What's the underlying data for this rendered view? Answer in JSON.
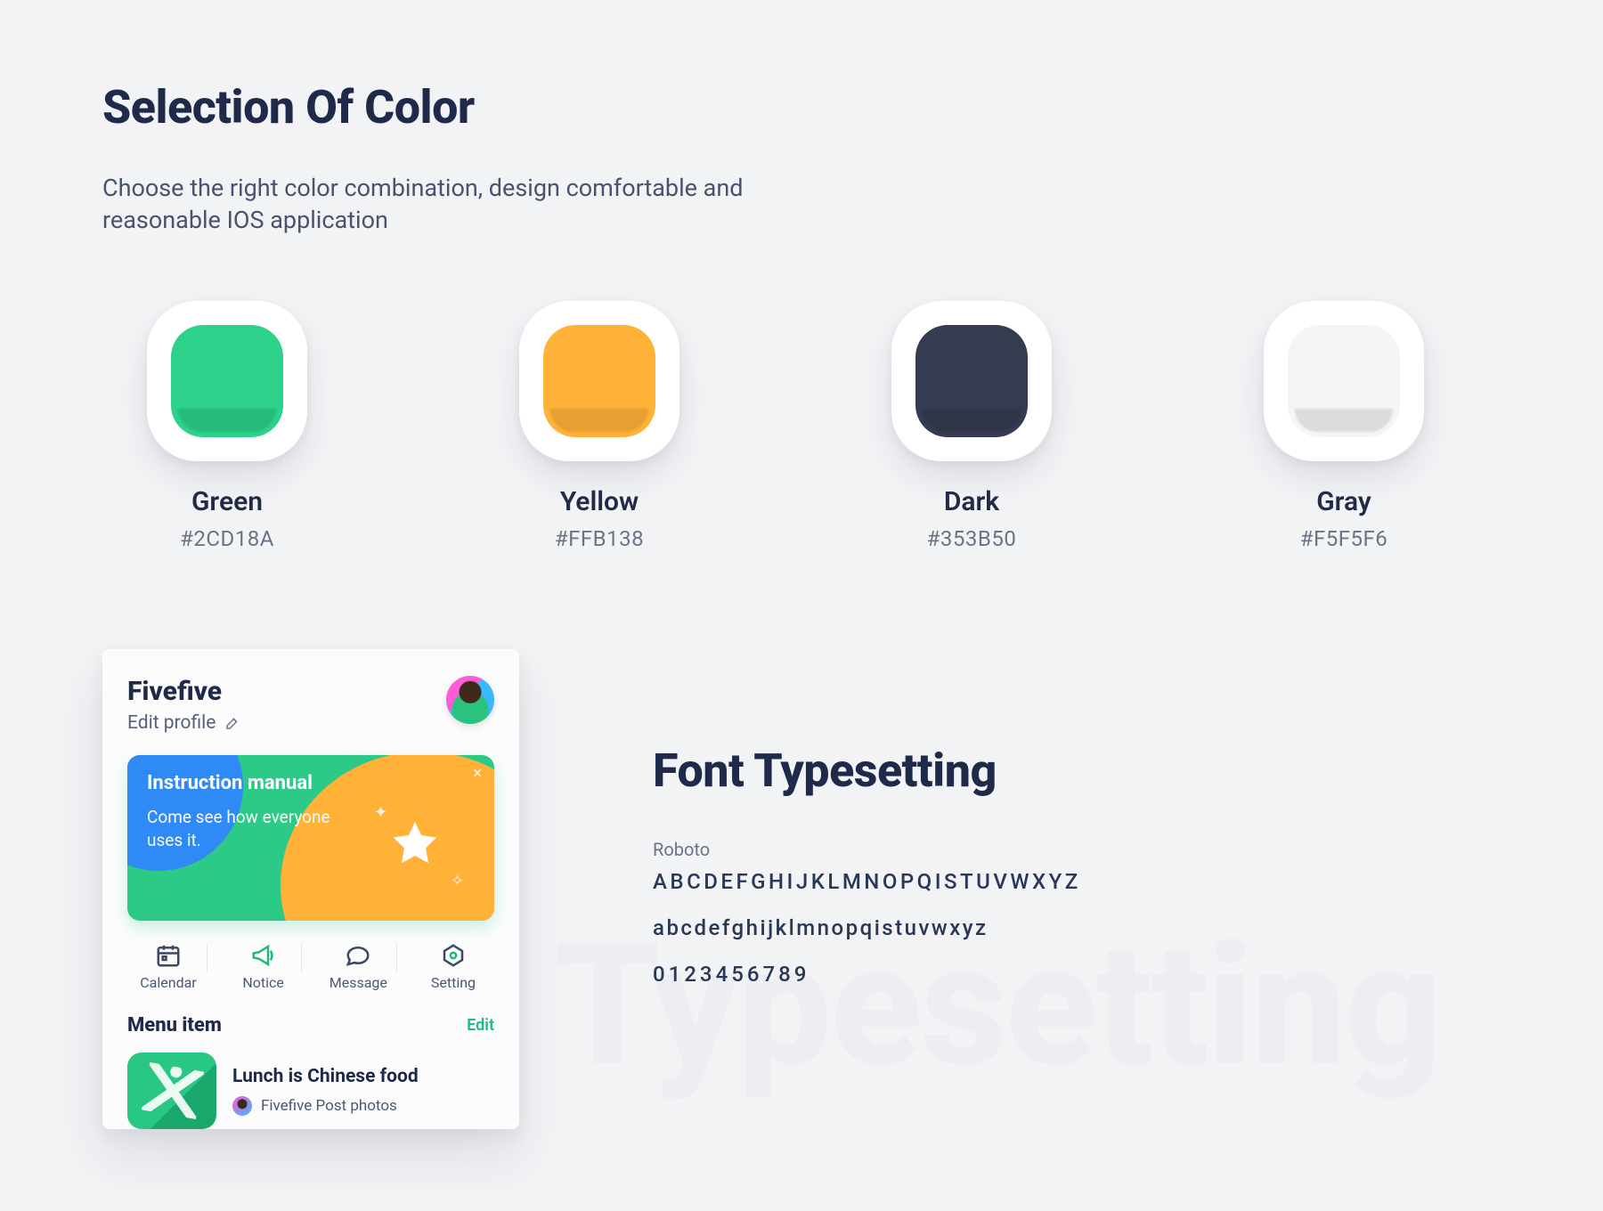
{
  "header": {
    "title": "Selection Of Color",
    "subtitle": "Choose the right color combination, design comfortable and reasonable IOS application"
  },
  "swatches": [
    {
      "name": "Green",
      "hex": "#2CD18A",
      "color": "#2CD18A"
    },
    {
      "name": "Yellow",
      "hex": "#FFB138",
      "color": "#FFB138"
    },
    {
      "name": "Dark",
      "hex": "#353B50",
      "color": "#353B50"
    },
    {
      "name": "Gray",
      "hex": "#F5F5F6",
      "color": "#F5F5F6"
    }
  ],
  "card": {
    "title": "Fivefive",
    "edit_profile": "Edit profile",
    "banner": {
      "title": "Instruction manual",
      "subtitle": "Come see how everyone uses it."
    },
    "quick": [
      {
        "key": "calendar",
        "label": "Calendar"
      },
      {
        "key": "notice",
        "label": "Notice"
      },
      {
        "key": "message",
        "label": "Message"
      },
      {
        "key": "setting",
        "label": "Setting"
      }
    ],
    "menu": {
      "title": "Menu item",
      "edit": "Edit",
      "item": {
        "title": "Lunch is Chinese food",
        "subtitle": "Fivefive Post photos"
      }
    }
  },
  "font": {
    "title": "Font Typesetting",
    "family": "Roboto",
    "upper": "ABCDEFGHIJKLMNOPQISTUVWXYZ",
    "lower": "abcdefghijklmnopqistuvwxyz",
    "numbers": "0123456789",
    "ghost": "Typesetting"
  }
}
